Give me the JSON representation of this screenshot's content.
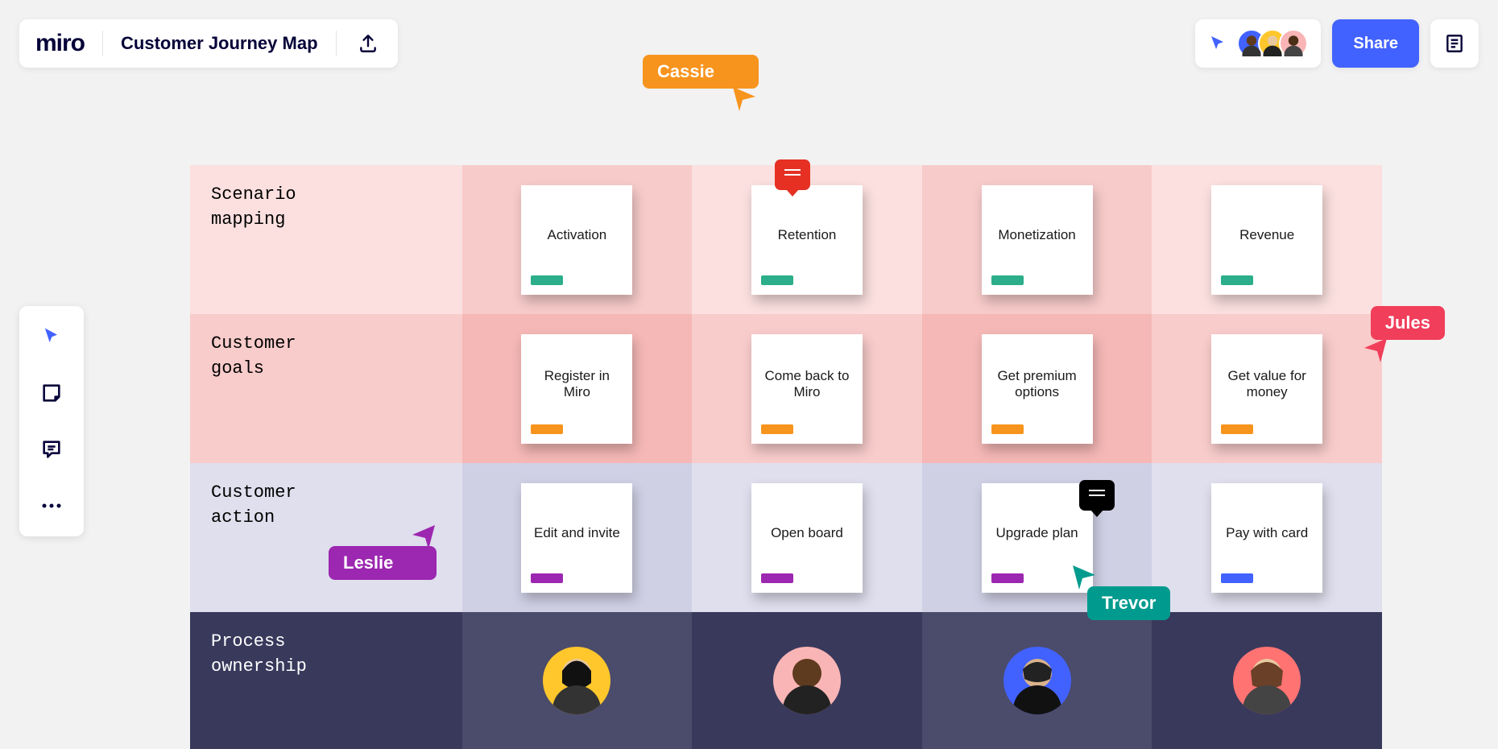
{
  "header": {
    "logo": "miro",
    "board_title": "Customer Journey Map",
    "share_label": "Share"
  },
  "cursors": {
    "cassie": {
      "name": "Cassie",
      "color": "#F7941D"
    },
    "jules": {
      "name": "Jules",
      "color": "#F03E5B"
    },
    "leslie": {
      "name": "Leslie",
      "color": "#9C27B0"
    },
    "trevor": {
      "name": "Trevor",
      "color": "#009B8E"
    }
  },
  "rows": [
    {
      "key": "scenario",
      "label": "Scenario\nmapping",
      "tag_color": "#2BAE89",
      "cards": [
        "Activation",
        "Retention",
        "Monetization",
        "Revenue"
      ]
    },
    {
      "key": "goals",
      "label": "Customer\ngoals",
      "tag_color": "#F7941D",
      "cards": [
        "Register in Miro",
        "Come back to Miro",
        "Get premium options",
        "Get value for money"
      ]
    },
    {
      "key": "actions",
      "label": "Customer\naction",
      "tag_color": "#9C27B0",
      "cards": [
        "Edit and invite",
        "Open board",
        "Upgrade plan",
        "Pay with card"
      ],
      "tag_overrides": {
        "3": "#4262FF"
      }
    },
    {
      "key": "ownership",
      "label": "Process\nownership",
      "avatars": [
        {
          "bg": "#FFC72C"
        },
        {
          "bg": "#F9B5B5"
        },
        {
          "bg": "#4262FF"
        },
        {
          "bg": "#FF7373"
        }
      ]
    }
  ]
}
